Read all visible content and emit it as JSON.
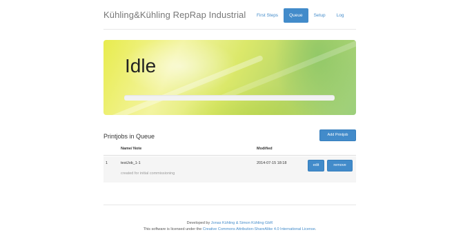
{
  "header": {
    "brand": "Kühling&Kühling RepRap Industrial",
    "nav": [
      {
        "label": "First Steps",
        "active": false
      },
      {
        "label": "Queue",
        "active": true
      },
      {
        "label": "Setup",
        "active": false
      },
      {
        "label": "Log",
        "active": false
      }
    ]
  },
  "status": {
    "title": "Idle",
    "progress": 0
  },
  "queue": {
    "title": "Printjobs in Queue",
    "add_label": "Add Printjob",
    "columns": {
      "num": "",
      "name": "Name/ Note",
      "modified": "Modified"
    },
    "rows": [
      {
        "num": "1",
        "name": "testJob_1-1",
        "note": "created for initial commissioning",
        "modified": "2014-07-15 18:18",
        "edit_label": "edit",
        "remove_label": "remove"
      }
    ]
  },
  "footer": {
    "line1_prefix": "Developed by ",
    "line1_link": "Jonas Kühling & Simon Kühling GbR",
    "line2_prefix": "This software is licensed under the ",
    "line2_link": "Creative Commons Attribution-ShareAlike 4.0 International License",
    "line2_suffix": "."
  },
  "colors": {
    "accent": "#428bca",
    "row_bg": "#f5f5f5"
  }
}
